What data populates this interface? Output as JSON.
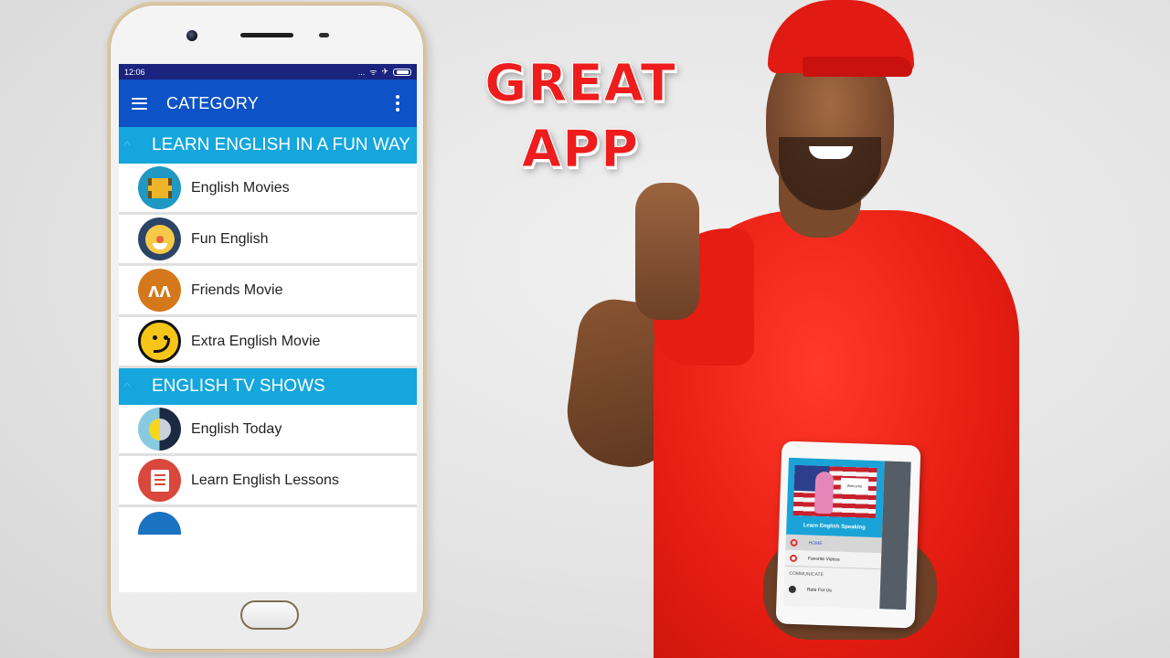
{
  "headline": {
    "line1": "GREAT",
    "line2": "APP",
    "color": "#ee1c1c"
  },
  "phone": {
    "statusbar": {
      "time": "12:06",
      "icons": [
        "more-dots-icon",
        "wifi-icon",
        "airplane-icon",
        "battery-icon"
      ],
      "dots": "...",
      "wifi": "ᯤ",
      "airplane": "✈"
    },
    "appbar": {
      "title": "CATEGORY",
      "menu_icon": "hamburger-icon",
      "overflow_icon": "kebab-menu-icon",
      "color": "#0d52c6"
    },
    "sections": [
      {
        "title": "LEARN ENGLISH IN A FUN WAY",
        "color": "#14a6dc",
        "items": [
          {
            "label": "English Movies",
            "icon": "film-icon"
          },
          {
            "label": "Fun English",
            "icon": "clown-face-icon"
          },
          {
            "label": "Friends Movie",
            "icon": "friends-icon"
          },
          {
            "label": "Extra English Movie",
            "icon": "smiley-icon"
          }
        ]
      },
      {
        "title": "ENGLISH TV SHOWS",
        "color": "#14a6dc",
        "items": [
          {
            "label": "English Today",
            "icon": "day-night-icon"
          },
          {
            "label": "Learn English Lessons",
            "icon": "document-icon"
          },
          {
            "label": "",
            "icon": "community-icon"
          }
        ]
      }
    ],
    "chevron": "^",
    "friends_glyph": "ᴧᴧ"
  },
  "tablet": {
    "banner_caption": "Learn English Speaking",
    "welcome_card": "Welcome",
    "menu": [
      {
        "label": "HOME",
        "active": true
      },
      {
        "label": "Favorite Videos",
        "active": false
      }
    ],
    "section_label": "COMMUNICATE",
    "section_items": [
      {
        "label": "Rate For Us"
      }
    ]
  }
}
